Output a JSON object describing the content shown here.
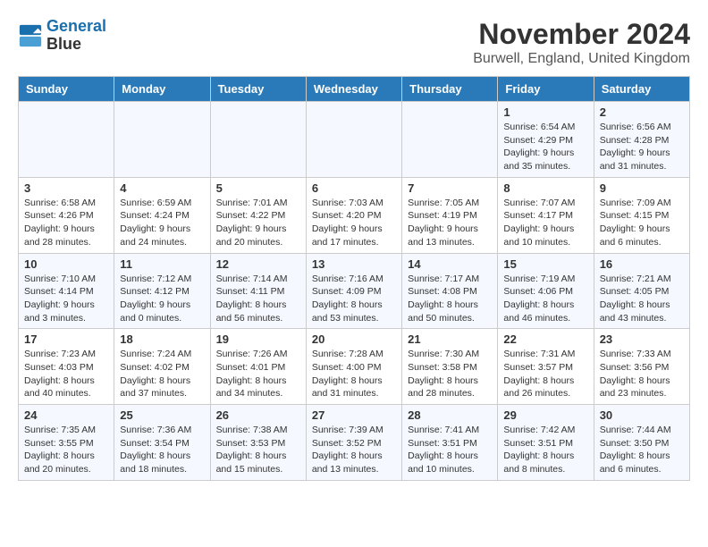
{
  "header": {
    "logo_line1": "General",
    "logo_line2": "Blue",
    "month": "November 2024",
    "location": "Burwell, England, United Kingdom"
  },
  "weekdays": [
    "Sunday",
    "Monday",
    "Tuesday",
    "Wednesday",
    "Thursday",
    "Friday",
    "Saturday"
  ],
  "weeks": [
    [
      {
        "day": "",
        "info": ""
      },
      {
        "day": "",
        "info": ""
      },
      {
        "day": "",
        "info": ""
      },
      {
        "day": "",
        "info": ""
      },
      {
        "day": "",
        "info": ""
      },
      {
        "day": "1",
        "info": "Sunrise: 6:54 AM\nSunset: 4:29 PM\nDaylight: 9 hours\nand 35 minutes."
      },
      {
        "day": "2",
        "info": "Sunrise: 6:56 AM\nSunset: 4:28 PM\nDaylight: 9 hours\nand 31 minutes."
      }
    ],
    [
      {
        "day": "3",
        "info": "Sunrise: 6:58 AM\nSunset: 4:26 PM\nDaylight: 9 hours\nand 28 minutes."
      },
      {
        "day": "4",
        "info": "Sunrise: 6:59 AM\nSunset: 4:24 PM\nDaylight: 9 hours\nand 24 minutes."
      },
      {
        "day": "5",
        "info": "Sunrise: 7:01 AM\nSunset: 4:22 PM\nDaylight: 9 hours\nand 20 minutes."
      },
      {
        "day": "6",
        "info": "Sunrise: 7:03 AM\nSunset: 4:20 PM\nDaylight: 9 hours\nand 17 minutes."
      },
      {
        "day": "7",
        "info": "Sunrise: 7:05 AM\nSunset: 4:19 PM\nDaylight: 9 hours\nand 13 minutes."
      },
      {
        "day": "8",
        "info": "Sunrise: 7:07 AM\nSunset: 4:17 PM\nDaylight: 9 hours\nand 10 minutes."
      },
      {
        "day": "9",
        "info": "Sunrise: 7:09 AM\nSunset: 4:15 PM\nDaylight: 9 hours\nand 6 minutes."
      }
    ],
    [
      {
        "day": "10",
        "info": "Sunrise: 7:10 AM\nSunset: 4:14 PM\nDaylight: 9 hours\nand 3 minutes."
      },
      {
        "day": "11",
        "info": "Sunrise: 7:12 AM\nSunset: 4:12 PM\nDaylight: 9 hours\nand 0 minutes."
      },
      {
        "day": "12",
        "info": "Sunrise: 7:14 AM\nSunset: 4:11 PM\nDaylight: 8 hours\nand 56 minutes."
      },
      {
        "day": "13",
        "info": "Sunrise: 7:16 AM\nSunset: 4:09 PM\nDaylight: 8 hours\nand 53 minutes."
      },
      {
        "day": "14",
        "info": "Sunrise: 7:17 AM\nSunset: 4:08 PM\nDaylight: 8 hours\nand 50 minutes."
      },
      {
        "day": "15",
        "info": "Sunrise: 7:19 AM\nSunset: 4:06 PM\nDaylight: 8 hours\nand 46 minutes."
      },
      {
        "day": "16",
        "info": "Sunrise: 7:21 AM\nSunset: 4:05 PM\nDaylight: 8 hours\nand 43 minutes."
      }
    ],
    [
      {
        "day": "17",
        "info": "Sunrise: 7:23 AM\nSunset: 4:03 PM\nDaylight: 8 hours\nand 40 minutes."
      },
      {
        "day": "18",
        "info": "Sunrise: 7:24 AM\nSunset: 4:02 PM\nDaylight: 8 hours\nand 37 minutes."
      },
      {
        "day": "19",
        "info": "Sunrise: 7:26 AM\nSunset: 4:01 PM\nDaylight: 8 hours\nand 34 minutes."
      },
      {
        "day": "20",
        "info": "Sunrise: 7:28 AM\nSunset: 4:00 PM\nDaylight: 8 hours\nand 31 minutes."
      },
      {
        "day": "21",
        "info": "Sunrise: 7:30 AM\nSunset: 3:58 PM\nDaylight: 8 hours\nand 28 minutes."
      },
      {
        "day": "22",
        "info": "Sunrise: 7:31 AM\nSunset: 3:57 PM\nDaylight: 8 hours\nand 26 minutes."
      },
      {
        "day": "23",
        "info": "Sunrise: 7:33 AM\nSunset: 3:56 PM\nDaylight: 8 hours\nand 23 minutes."
      }
    ],
    [
      {
        "day": "24",
        "info": "Sunrise: 7:35 AM\nSunset: 3:55 PM\nDaylight: 8 hours\nand 20 minutes."
      },
      {
        "day": "25",
        "info": "Sunrise: 7:36 AM\nSunset: 3:54 PM\nDaylight: 8 hours\nand 18 minutes."
      },
      {
        "day": "26",
        "info": "Sunrise: 7:38 AM\nSunset: 3:53 PM\nDaylight: 8 hours\nand 15 minutes."
      },
      {
        "day": "27",
        "info": "Sunrise: 7:39 AM\nSunset: 3:52 PM\nDaylight: 8 hours\nand 13 minutes."
      },
      {
        "day": "28",
        "info": "Sunrise: 7:41 AM\nSunset: 3:51 PM\nDaylight: 8 hours\nand 10 minutes."
      },
      {
        "day": "29",
        "info": "Sunrise: 7:42 AM\nSunset: 3:51 PM\nDaylight: 8 hours\nand 8 minutes."
      },
      {
        "day": "30",
        "info": "Sunrise: 7:44 AM\nSunset: 3:50 PM\nDaylight: 8 hours\nand 6 minutes."
      }
    ]
  ]
}
